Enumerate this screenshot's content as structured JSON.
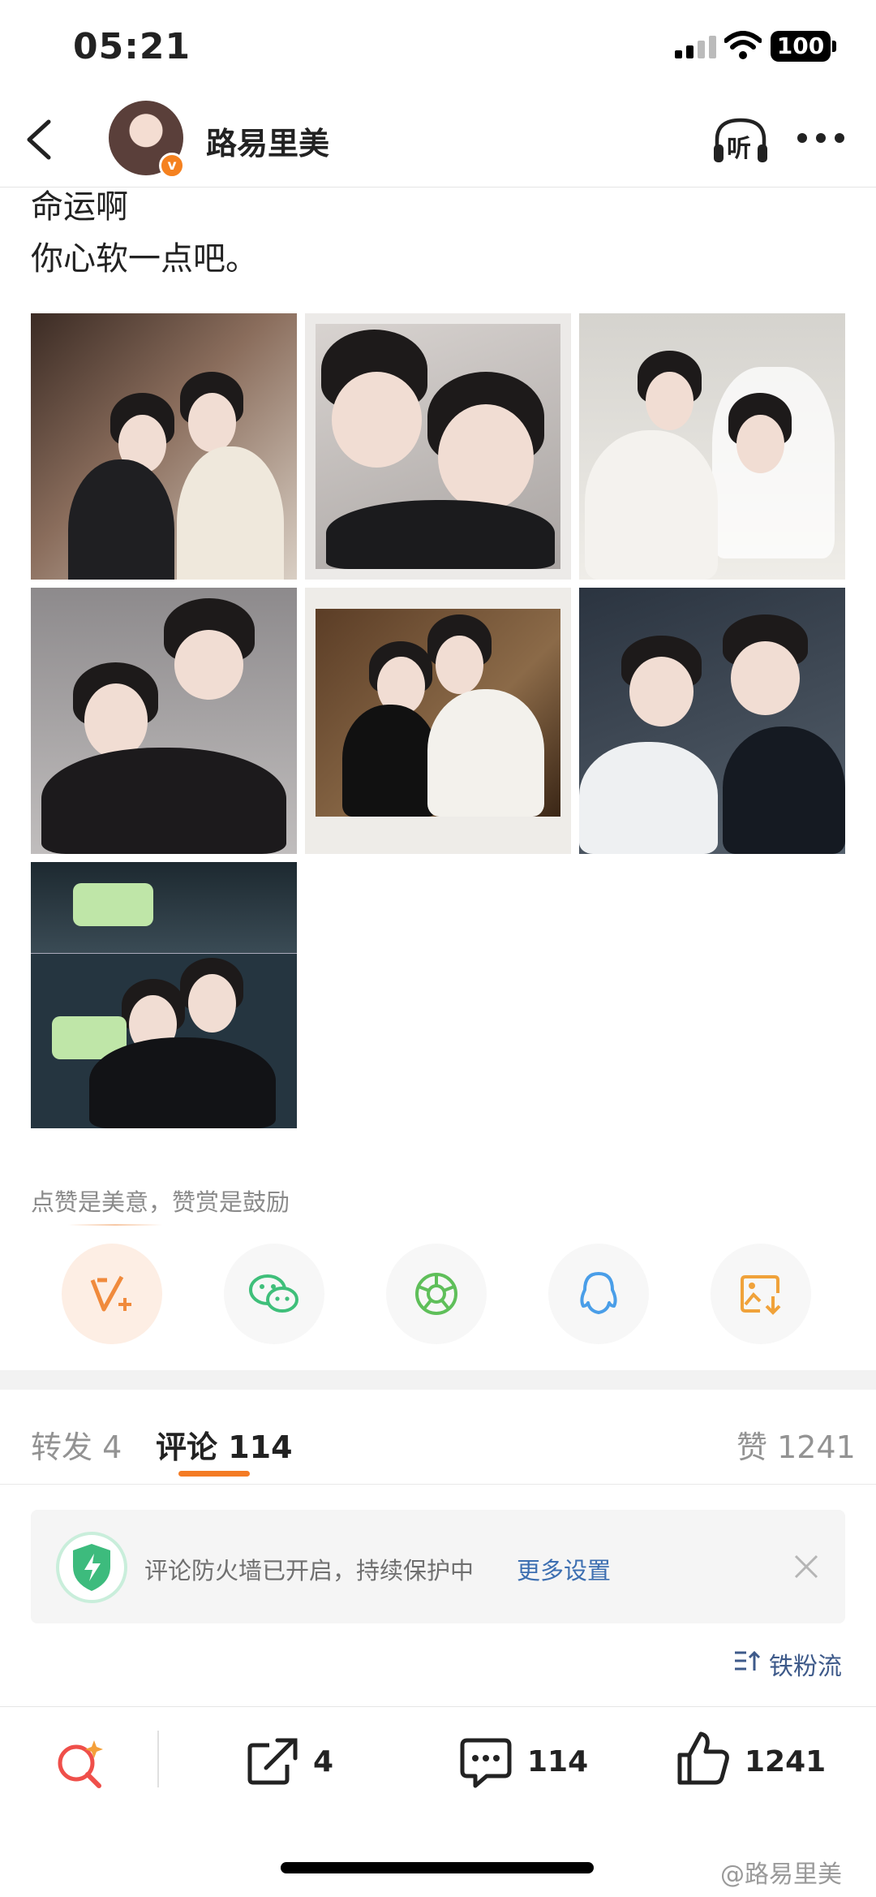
{
  "status_bar": {
    "time": "05:21",
    "battery": "100"
  },
  "header": {
    "username": "路易里美",
    "verified_badge": "v",
    "listen_label": "听"
  },
  "post": {
    "lines": [
      "命运啊",
      "你心软一点吧。"
    ],
    "image_count": 7
  },
  "reward": {
    "text": "点赞是美意，赞赏是鼓励"
  },
  "share_icons": [
    "vplus-icon",
    "wechat-icon",
    "moments-icon",
    "qq-icon",
    "save-image-icon"
  ],
  "tabs": {
    "repost": "转发 4",
    "comment": "评论 114",
    "like": "赞 1241"
  },
  "firewall": {
    "text": "评论防火墙已开启，持续保护中",
    "link": "更多设置"
  },
  "sort_label": "铁粉流",
  "bottom_bar": {
    "repost_count": "4",
    "comment_count": "114",
    "like_count": "1241"
  },
  "watermark": "@路易里美",
  "colors": {
    "accent_orange": "#f47b24",
    "link_blue": "#3d6fb1",
    "badge_orange": "#f5811f"
  }
}
